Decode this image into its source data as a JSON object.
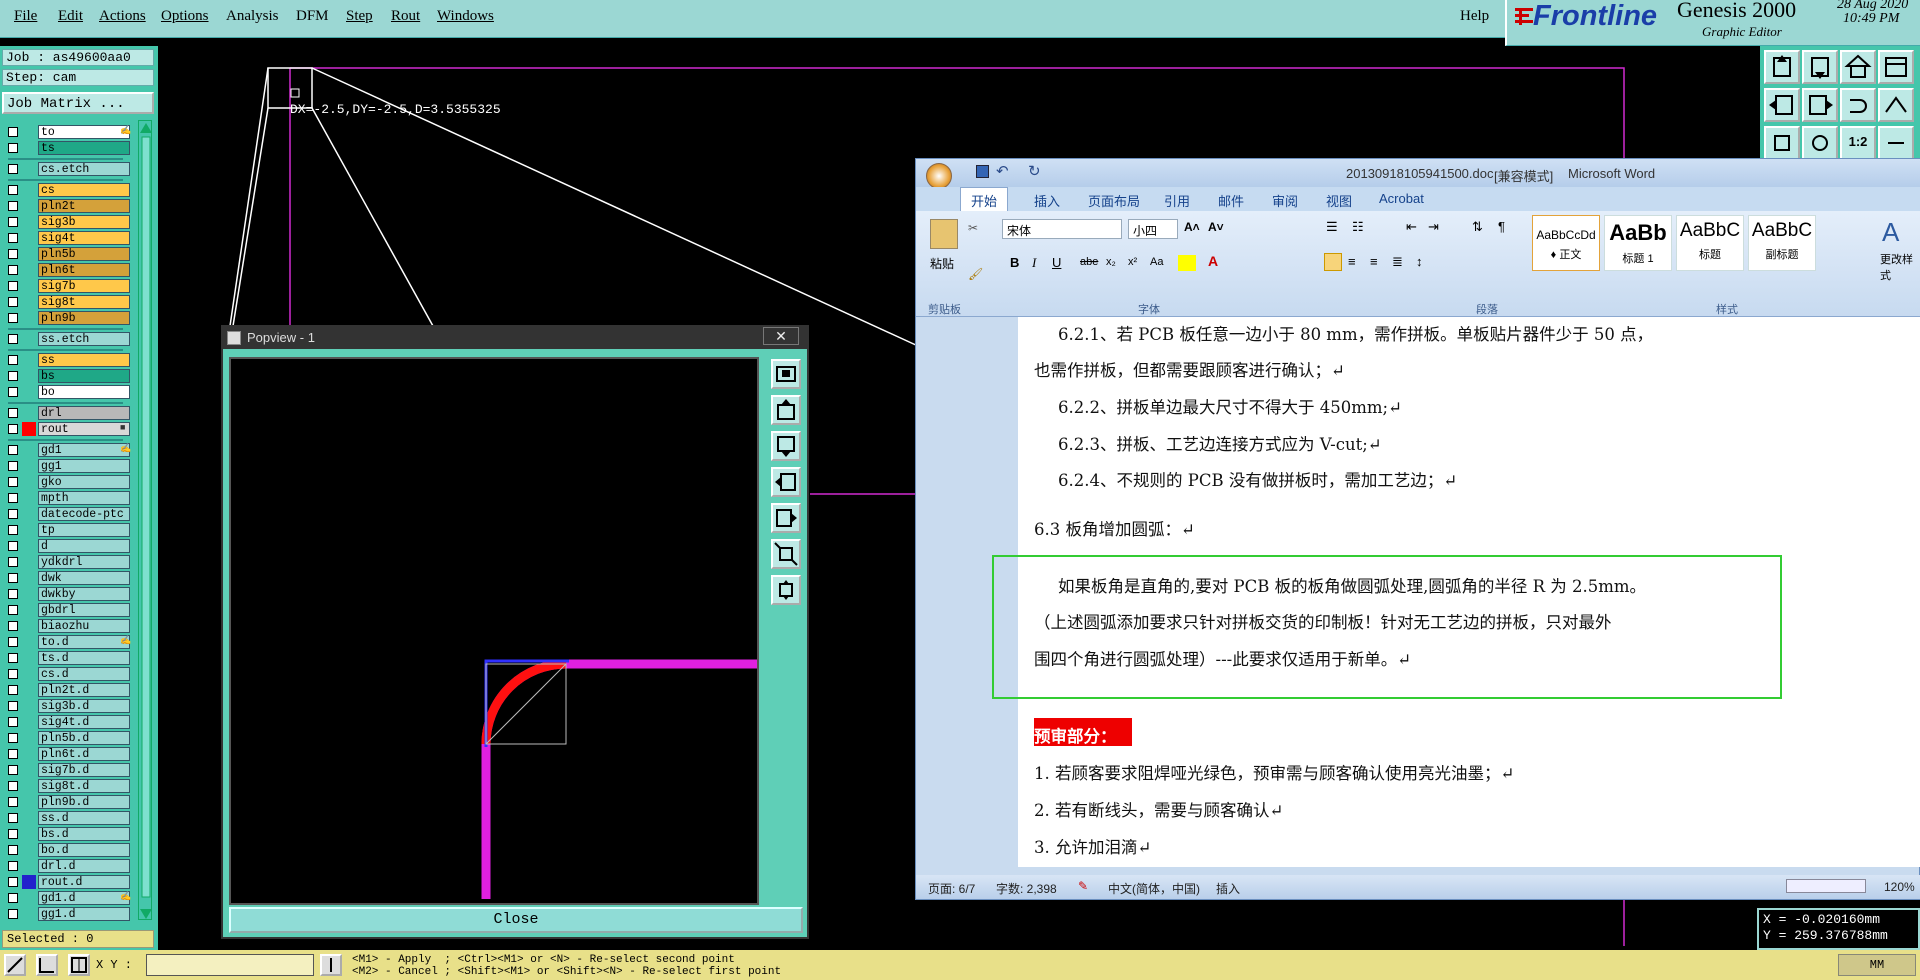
{
  "menubar": {
    "items": [
      "File",
      "Edit",
      "Actions",
      "Options",
      "Analysis",
      "DFM",
      "Step",
      "Rout",
      "Windows"
    ],
    "help": "Help"
  },
  "brand": {
    "logo": "Frontline",
    "product": "Genesis 2000",
    "subtitle": "Graphic Editor",
    "date": "28 Aug 2020",
    "time": "10:49 PM"
  },
  "job": {
    "job_label": "Job : as49600aa0",
    "step_label": "Step: cam",
    "matrix_button": "Job Matrix ..."
  },
  "layers": [
    {
      "name": "to",
      "color": "#ffffff",
      "mark": "✍"
    },
    {
      "name": "ts",
      "color": "#1fa887"
    },
    {
      "name": "cs.etch",
      "color": "#9bd7d3",
      "gap": true
    },
    {
      "name": "cs",
      "color": "#ffc84a",
      "gap": true
    },
    {
      "name": "pln2t",
      "color": "#d4a13a"
    },
    {
      "name": "sig3b",
      "color": "#ffc84a"
    },
    {
      "name": "sig4t",
      "color": "#ffc84a"
    },
    {
      "name": "pln5b",
      "color": "#d4a13a"
    },
    {
      "name": "pln6t",
      "color": "#d4a13a"
    },
    {
      "name": "sig7b",
      "color": "#ffc84a"
    },
    {
      "name": "sig8t",
      "color": "#ffc84a"
    },
    {
      "name": "pln9b",
      "color": "#d4a13a"
    },
    {
      "name": "ss.etch",
      "color": "#9bd7d3",
      "gap": true
    },
    {
      "name": "ss",
      "color": "#ffc84a",
      "gap": true
    },
    {
      "name": "bs",
      "color": "#1fa887"
    },
    {
      "name": "bo",
      "color": "#ffffff"
    },
    {
      "name": "drl",
      "color": "#b8b8b8",
      "gap": true
    },
    {
      "name": "rout",
      "color": "#d8d8d8",
      "active": true,
      "mark": "■"
    },
    {
      "name": "gd1",
      "color": "#9bd7d3",
      "gap": true,
      "mark": "✍"
    },
    {
      "name": "gg1",
      "color": "#9bd7d3"
    },
    {
      "name": "gko",
      "color": "#9bd7d3"
    },
    {
      "name": "mpth",
      "color": "#9bd7d3"
    },
    {
      "name": "datecode-ptc",
      "color": "#9bd7d3"
    },
    {
      "name": "tp",
      "color": "#9bd7d3"
    },
    {
      "name": "d",
      "color": "#9bd7d3"
    },
    {
      "name": "ydkdrl",
      "color": "#9bd7d3"
    },
    {
      "name": "dwk",
      "color": "#9bd7d3"
    },
    {
      "name": "dwkby",
      "color": "#9bd7d3"
    },
    {
      "name": "gbdrl",
      "color": "#9bd7d3"
    },
    {
      "name": "biaozhu",
      "color": "#9bd7d3"
    },
    {
      "name": "to.d",
      "color": "#9bd7d3",
      "mark": "✍"
    },
    {
      "name": "ts.d",
      "color": "#9bd7d3"
    },
    {
      "name": "cs.d",
      "color": "#9bd7d3"
    },
    {
      "name": "pln2t.d",
      "color": "#9bd7d3"
    },
    {
      "name": "sig3b.d",
      "color": "#9bd7d3"
    },
    {
      "name": "sig4t.d",
      "color": "#9bd7d3"
    },
    {
      "name": "pln5b.d",
      "color": "#9bd7d3"
    },
    {
      "name": "pln6t.d",
      "color": "#9bd7d3"
    },
    {
      "name": "sig7b.d",
      "color": "#9bd7d3"
    },
    {
      "name": "sig8t.d",
      "color": "#9bd7d3"
    },
    {
      "name": "pln9b.d",
      "color": "#9bd7d3"
    },
    {
      "name": "ss.d",
      "color": "#9bd7d3"
    },
    {
      "name": "bs.d",
      "color": "#9bd7d3"
    },
    {
      "name": "bo.d",
      "color": "#9bd7d3"
    },
    {
      "name": "drl.d",
      "color": "#9bd7d3"
    },
    {
      "name": "rout.d",
      "color": "#9bd7d3",
      "blue": true
    },
    {
      "name": "gd1.d",
      "color": "#9bd7d3",
      "mark": "✍"
    },
    {
      "name": "gg1.d",
      "color": "#9bd7d3"
    }
  ],
  "selected_label": "Selected : 0",
  "measure_text": "DX=-2.5,DY=-2.5,D=3.5355325",
  "popview": {
    "title": "Popview - 1",
    "close_label": "Close"
  },
  "word": {
    "title_file": "20130918105941500.doc",
    "title_mode": "[兼容模式]",
    "title_app": "Microsoft Word",
    "tabs": [
      "开始",
      "插入",
      "页面布局",
      "引用",
      "邮件",
      "审阅",
      "视图",
      "Acrobat"
    ],
    "font_name": "宋体",
    "font_size": "小四",
    "paste_label": "粘贴",
    "group_clipboard": "剪贴板",
    "group_font": "字体",
    "group_paragraph": "段落",
    "group_styles": "样式",
    "styles": [
      {
        "sample": "AaBbCcDd",
        "name": "♦ 正文"
      },
      {
        "sample": "AaBb",
        "name": "标题 1"
      },
      {
        "sample": "AaBbC",
        "name": "标题"
      },
      {
        "sample": "AaBbC",
        "name": "副标题"
      }
    ],
    "change_styles": "更改样式",
    "doc_lines": [
      "6.2.1、若 PCB 板任意一边小于 80 mm，需作拼板。单板贴片器件少于 50 点，",
      "也需作拼板，但都需要跟顾客进行确认；↵",
      "6.2.2、拼板单边最大尺寸不得大于 450mm;↵",
      "6.2.3、拼板、工艺边连接方式应为 V-cut;↵",
      "6.2.4、不规则的 PCB 没有做拼板时，需加工艺边；↵",
      "6.3 板角增加圆弧：↵",
      "如果板角是直角的,要对 PCB 板的板角做圆弧处理,圆弧角的半径 R 为 2.5mm。",
      "（上述圆弧添加要求只针对拼板交货的印制板！针对无工艺边的拼板，只对最外",
      "围四个角进行圆弧处理）---此要求仅适用于新单。↵",
      "预审部分：",
      "1.   若顾客要求阻焊哑光绿色，预审需与顾客确认使用亮光油墨；↵",
      "2.   若有断线头，需要与顾客确认↵",
      "3.   允许加泪滴↵"
    ],
    "status": {
      "page": "页面: 6/7",
      "words": "字数: 2,398",
      "lang": "中文(简体，中国)",
      "mode": "插入",
      "zoom": "120%"
    }
  },
  "coords": {
    "x": "X = -0.020160mm",
    "y": "Y = 259.376788mm"
  },
  "bottom": {
    "xy_label": "X Y :",
    "xy_value": "",
    "hint1": "<M1> - Apply  ; <Ctrl><M1> or <N> - Re-select second point",
    "hint2": "<M2> - Cancel ; <Shift><M1> or <Shift><N> - Re-select first point",
    "units": "MM"
  }
}
